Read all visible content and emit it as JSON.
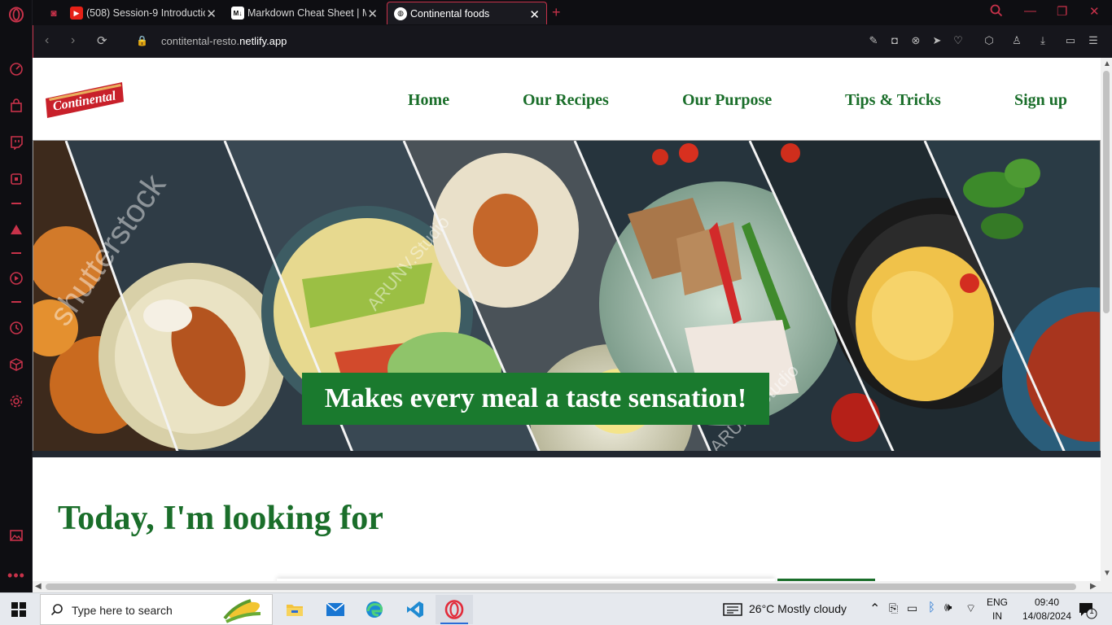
{
  "browser": {
    "tabs": [
      {
        "title": "(508) Session-9 Introductio",
        "icon": "youtube-icon"
      },
      {
        "title": "Markdown Cheat Sheet | M",
        "icon": "markdown-icon"
      },
      {
        "title": "Continental foods",
        "icon": "globe-icon",
        "active": true
      }
    ],
    "url_domain": "contitental-resto.",
    "url_bold": "netlify.app"
  },
  "site": {
    "logo_text": "Continental",
    "nav": [
      "Home",
      "Our Recipes",
      "Our Purpose",
      "Tips & Tricks",
      "Sign up"
    ],
    "tagline": "Makes every meal a taste sensation!",
    "section_heading": "Today, I'm looking for",
    "watermarks": [
      "shutterstock",
      "ARUNV.Studio",
      "ARUNV.Studio"
    ]
  },
  "taskbar": {
    "search_placeholder": "Type here to search",
    "weather": "26°C  Mostly cloudy",
    "lang_top": "ENG",
    "lang_bottom": "IN",
    "time": "09:40",
    "date": "14/08/2024",
    "notification_count": "1"
  },
  "colors": {
    "brand_green": "#1a6e2a",
    "tagline_bg": "#1a7a2e",
    "opera_red": "#c8324a",
    "logo_red": "#c8202a"
  }
}
